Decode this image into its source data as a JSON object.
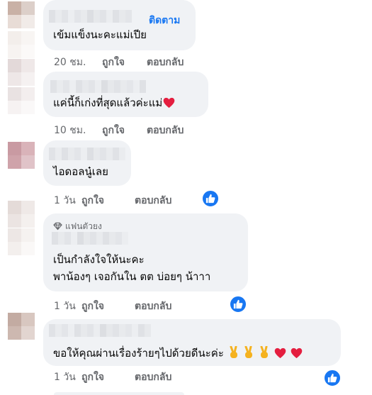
{
  "comments": [
    {
      "text": "เข้มแข็งนะคะแม่เปีย",
      "follow_label": "ติดตาม",
      "time": "20 ชม.",
      "like_label": "ถูกใจ",
      "reply_label": "ตอบกลับ"
    },
    {
      "text": "แค่นี้ก็เก่งที่สุดแล้วค่ะแม่",
      "emoji": [
        "red-heart"
      ],
      "time": "10 ชม.",
      "like_label": "ถูกใจ",
      "reply_label": "ตอบกลับ"
    },
    {
      "text": "ไอดอลนู๋เลย",
      "time": "1 วัน",
      "like_label": "ถูกใจ",
      "reply_label": "ตอบกลับ",
      "reaction": "like"
    },
    {
      "badge_label": "แฟนตัวยง",
      "text_lines": [
        "เป็นกำลังใจให้นะคะ",
        "พาน้องๆ เจอกันใน ตต บ่อยๆ น้าาา"
      ],
      "time": "1 วัน",
      "like_label": "ถูกใจ",
      "reply_label": "ตอบกลับ",
      "reaction": "like"
    },
    {
      "text": "ขอให้คุณผ่านเรื่องร้ายๆไปด้วยดีนะค่ะ",
      "emoji": [
        "victory-hand",
        "victory-hand",
        "victory-hand",
        "red-heart",
        "red-heart"
      ],
      "time": "1 วัน",
      "like_label": "ถูกใจ",
      "reply_label": "ตอบกลับ",
      "reaction": "like"
    }
  ],
  "colors": {
    "bubble": "#f0f2f5",
    "meta_text": "#65676b",
    "link_blue": "#1877f2",
    "heart_red": "#e41e3f"
  }
}
